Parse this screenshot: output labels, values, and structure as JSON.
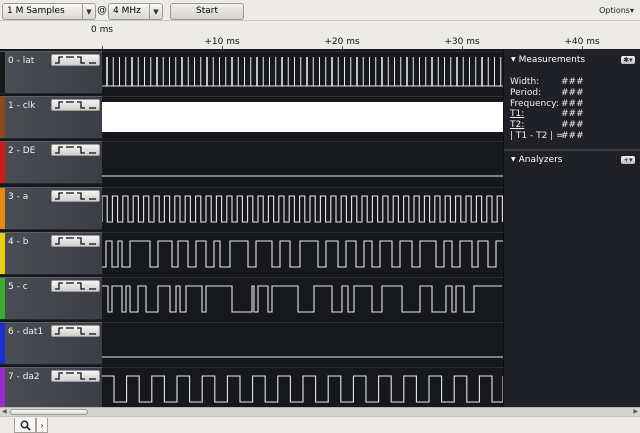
{
  "toolbar": {
    "samples_value": "1 M Samples",
    "at_symbol": "@",
    "rate_value": "4 MHz",
    "start_label": "Start",
    "options_label": "Options▾"
  },
  "timeline": {
    "zero_label": "0 ms",
    "ticks": [
      "+10 ms",
      "+20 ms",
      "+30 ms",
      "+40 ms"
    ]
  },
  "channels": [
    {
      "name": "0 - lat",
      "color": "#1a1a1a",
      "pattern": "pulses"
    },
    {
      "name": "1 - clk",
      "color": "#8a4a1c",
      "pattern": "solid"
    },
    {
      "name": "2 - DE",
      "color": "#d11a1a",
      "pattern": "low"
    },
    {
      "name": "3 - a",
      "color": "#e88a10",
      "pattern": "square"
    },
    {
      "name": "4 - b",
      "color": "#e8d010",
      "pattern": "irregular"
    },
    {
      "name": "5 - c",
      "color": "#36b02c",
      "pattern": "sparse"
    },
    {
      "name": "6 - dat1",
      "color": "#1a2fd1",
      "pattern": "low"
    },
    {
      "name": "7 - da2",
      "color": "#9a2ad1",
      "pattern": "square2"
    }
  ],
  "measurements": {
    "title": "Measurements",
    "rows": [
      {
        "label": "Width:",
        "value": "###",
        "underline": false
      },
      {
        "label": "Period:",
        "value": "###",
        "underline": false
      },
      {
        "label": "Frequency:",
        "value": "###",
        "underline": false
      },
      {
        "label": "T1:",
        "value": "###",
        "underline": true
      },
      {
        "label": "T2:",
        "value": "###",
        "underline": true
      },
      {
        "label": "| T1 - T2 | =",
        "value": "###",
        "underline": false
      }
    ]
  },
  "analyzers": {
    "title": "Analyzers"
  },
  "icons": {
    "dropdown": "chevron-down-icon",
    "gear": "gear-icon",
    "add": "add-icon",
    "search": "magnifier-icon",
    "trigger": "edge-trigger-icon"
  }
}
